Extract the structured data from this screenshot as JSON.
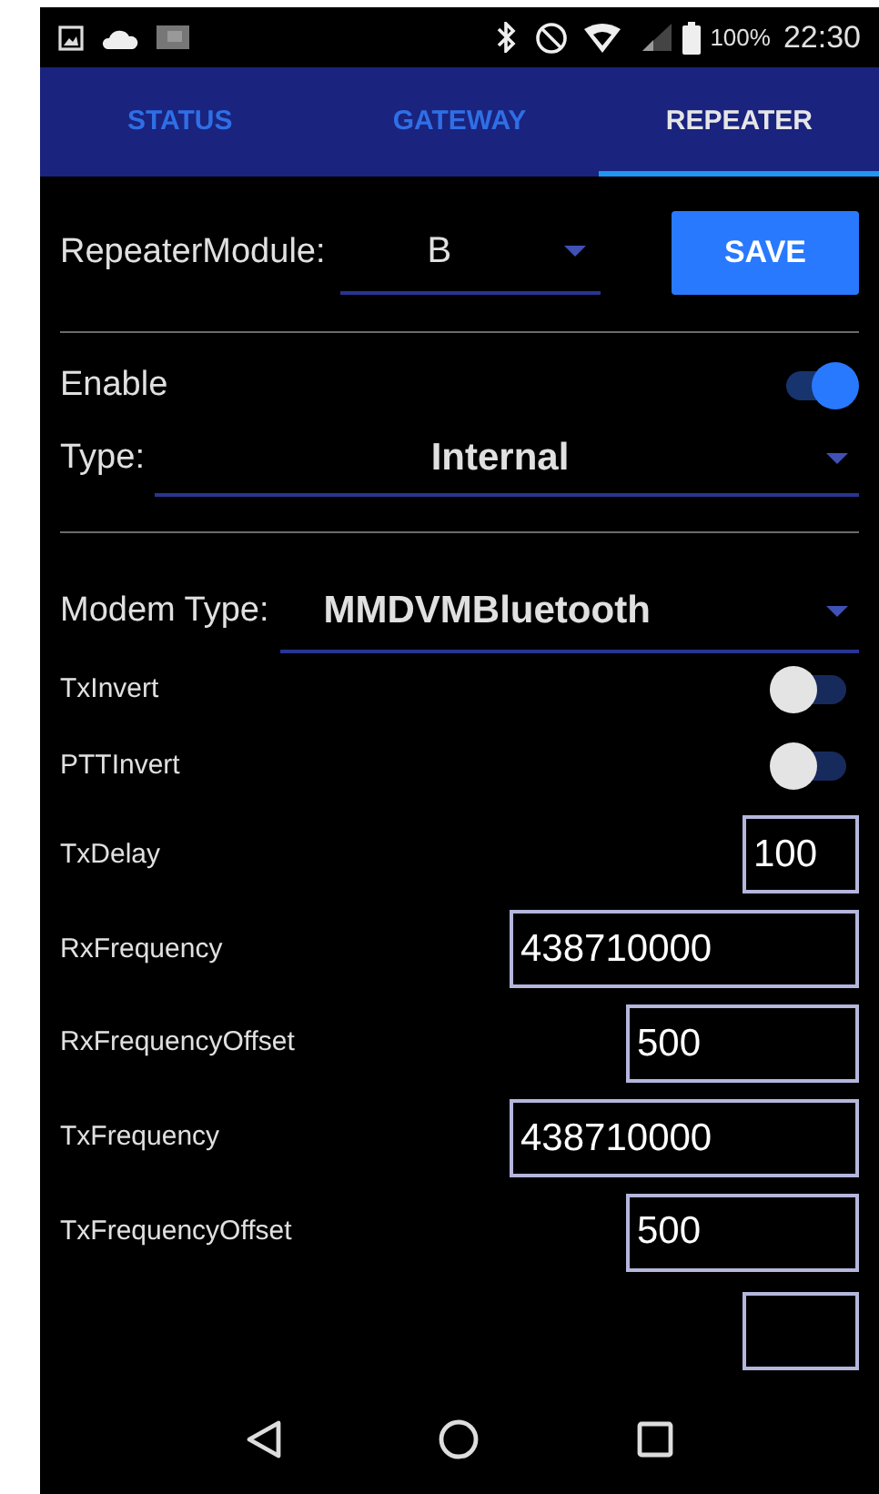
{
  "status_bar": {
    "battery": "100%",
    "time": "22:30"
  },
  "tabs": [
    {
      "label": "STATUS",
      "selected": false
    },
    {
      "label": "GATEWAY",
      "selected": false
    },
    {
      "label": "REPEATER",
      "selected": true
    }
  ],
  "module": {
    "label": "RepeaterModule:",
    "value": "B",
    "save": "SAVE"
  },
  "enable": {
    "label": "Enable",
    "on": true
  },
  "type": {
    "label": "Type:",
    "value": "Internal"
  },
  "modem": {
    "label": "Modem Type:",
    "value": "MMDVMBluetooth"
  },
  "settings": [
    {
      "kind": "switch",
      "label": "TxInvert",
      "on": false
    },
    {
      "kind": "switch",
      "label": "PTTInvert",
      "on": false
    },
    {
      "kind": "short",
      "label": "TxDelay",
      "value": "100"
    },
    {
      "kind": "wide",
      "label": "RxFrequency",
      "value": "438710000"
    },
    {
      "kind": "medium",
      "label": "RxFrequencyOffset",
      "value": "500"
    },
    {
      "kind": "wide",
      "label": "TxFrequency",
      "value": "438710000"
    },
    {
      "kind": "medium",
      "label": "TxFrequencyOffset",
      "value": "500"
    }
  ]
}
